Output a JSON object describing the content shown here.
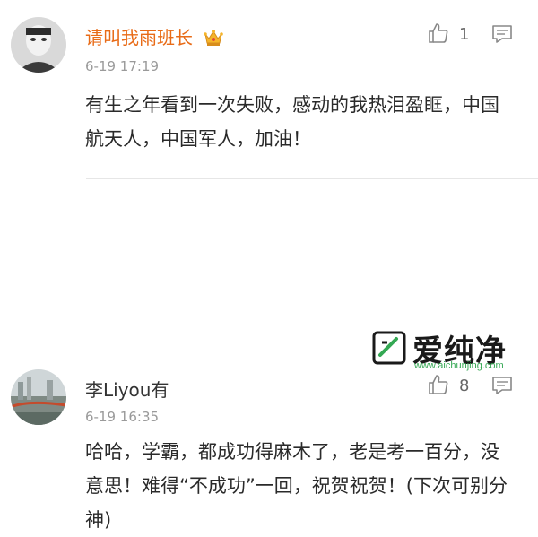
{
  "comments": [
    {
      "username": "请叫我雨班长",
      "time": "6-19 17:19",
      "text": "有生之年看到一次失败，感动的我热泪盈眶，中国航天人，中国军人，加油！",
      "likes": "1",
      "badge_icon": "crown-icon"
    },
    {
      "username": "李Liyou有",
      "time": "6-19 16:35",
      "text": "哈哈，学霸，都成功得麻木了，老是考一百分，没意思！难得“不成功”一回，祝贺祝贺！(下次可别分神)",
      "likes": "8"
    }
  ],
  "watermark": {
    "text": "爱纯净",
    "url": "www.aichunjing.com"
  },
  "colors": {
    "vip_name": "#e86b17",
    "watermark_url": "#34a853"
  }
}
